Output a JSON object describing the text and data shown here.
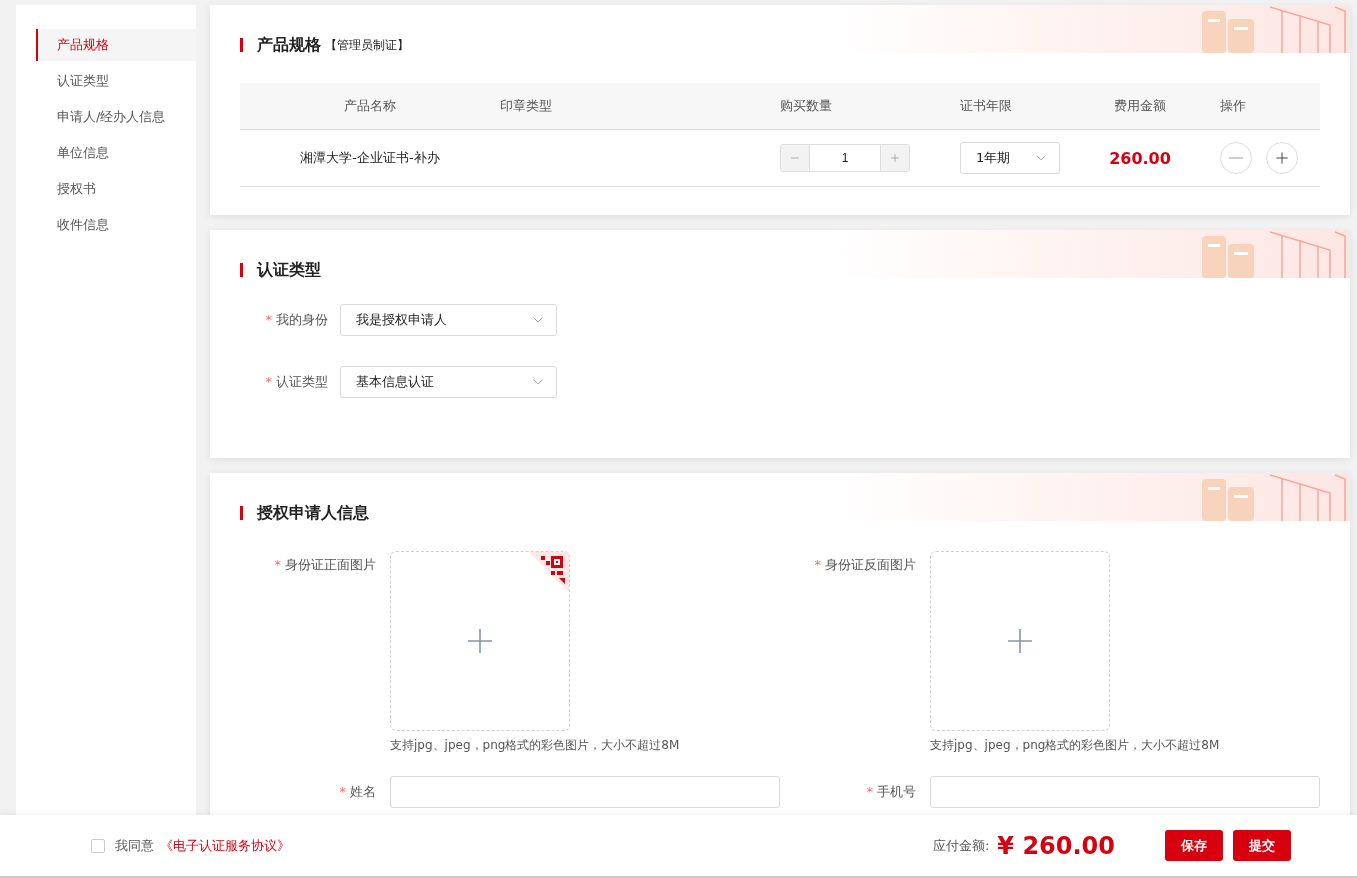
{
  "sidebar": {
    "items": [
      {
        "label": "产品规格",
        "selected": true
      },
      {
        "label": "认证类型",
        "selected": false
      },
      {
        "label": "申请人/经办人信息",
        "selected": false
      },
      {
        "label": "单位信息",
        "selected": false
      },
      {
        "label": "授权书",
        "selected": false
      },
      {
        "label": "收件信息",
        "selected": false
      }
    ]
  },
  "product_spec": {
    "title": "产品规格",
    "subtitle": "【管理员制证】",
    "columns": [
      "产品名称",
      "印章类型",
      "购买数量",
      "证书年限",
      "费用金额",
      "操作"
    ],
    "rows": [
      {
        "name": "湘潭大学-企业证书-补办",
        "quantity": "1",
        "term": "1年期",
        "amount": "260.00"
      }
    ]
  },
  "cert_type": {
    "title": "认证类型",
    "fields": [
      {
        "label": "我的身份",
        "value": "我是授权申请人",
        "required_mark": "*"
      },
      {
        "label": "认证类型",
        "value": "基本信息认证",
        "required_mark": "*"
      }
    ]
  },
  "applicant": {
    "title": "授权申请人信息",
    "uploads": [
      {
        "label": "身份证正面图片",
        "hint": "支持jpg、jpeg，png格式的彩色图片，大小不超过8M",
        "required_mark": "*",
        "scan_badge": true
      },
      {
        "label": "身份证反面图片",
        "hint": "支持jpg、jpeg，png格式的彩色图片，大小不超过8M",
        "required_mark": "*",
        "scan_badge": false
      }
    ],
    "fields": [
      {
        "label": "姓名",
        "required_mark": "*"
      },
      {
        "label": "手机号",
        "required_mark": "*"
      }
    ]
  },
  "footer": {
    "agree": {
      "label": "我同意",
      "link": "《电子认证服务协议》",
      "checked": false
    },
    "total_label": "应付金额:",
    "total": "¥ 260.00",
    "buttons": [
      "保存",
      "提交"
    ]
  }
}
